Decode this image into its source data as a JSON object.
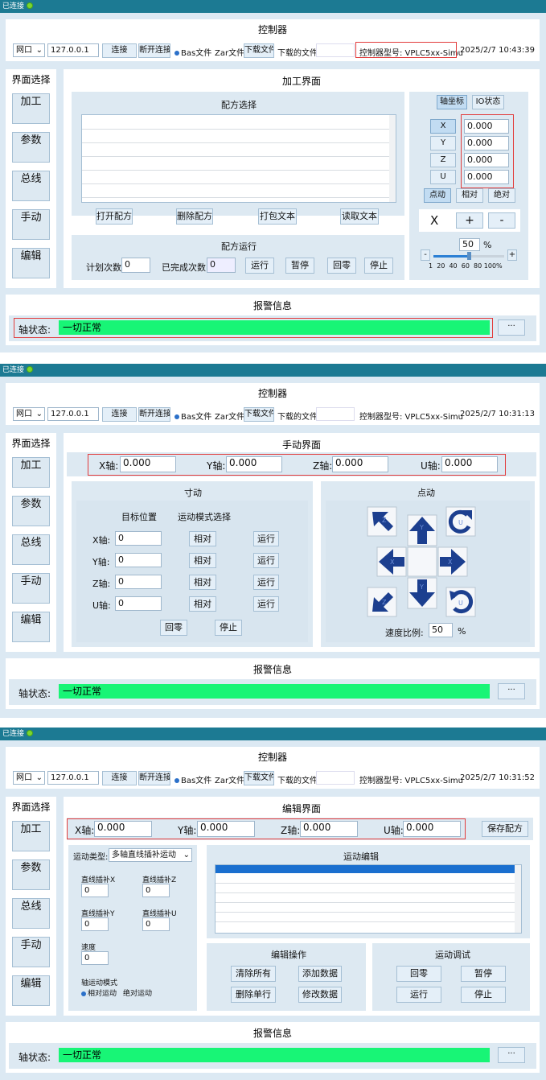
{
  "common": {
    "conn_status": "已连接",
    "controller_title": "控制器",
    "port": "网口",
    "ip": "127.0.0.1",
    "connect": "连接",
    "disconnect": "断开连接",
    "bas_file": "Bas文件",
    "zar_file": "Zar文件",
    "download_file": "下载文件",
    "downloaded_file": "下载的文件:",
    "model": "控制器型号: VPLC5xx-Simu",
    "menu_title": "界面选择",
    "menu": [
      "加工",
      "参数",
      "总线",
      "手动",
      "编辑"
    ],
    "alarm_title": "报警信息",
    "axis_state_label": "轴状态:",
    "axis_state": "一切正常",
    "more": "···"
  },
  "s1": {
    "datetime": "2025/2/7 10:43:39",
    "title": "加工界面",
    "recipe_select": "配方选择",
    "buttons": [
      "打开配方",
      "删除配方",
      "打包文本",
      "读取文本"
    ],
    "recipe_run": "配方运行",
    "plan_count_label": "计划次数",
    "plan_count": "0",
    "done_count_label": "已完成次数",
    "done_count": "0",
    "run_buttons": [
      "运行",
      "暂停",
      "回零",
      "停止"
    ],
    "tab_axis": "轴坐标",
    "tab_io": "IO状态",
    "axes": [
      "X",
      "Y",
      "Z",
      "U"
    ],
    "values": [
      "0.000",
      "0.000",
      "0.000",
      "0.000"
    ],
    "modes": [
      "点动",
      "相对",
      "绝对"
    ],
    "jog_axis": "X",
    "plus": "+",
    "minus": "-",
    "speed": "50",
    "pct": "%",
    "slider_pct": 0.5,
    "scale": [
      "1",
      "20",
      "40",
      "60",
      "80",
      "100%"
    ]
  },
  "s2": {
    "datetime": "2025/2/7 10:31:13",
    "title": "手动界面",
    "axes_labels": [
      "X轴:",
      "Y轴:",
      "Z轴:",
      "U轴:"
    ],
    "axes_values": [
      "0.000",
      "0.000",
      "0.000",
      "0.000"
    ],
    "inch_title": "寸动",
    "target_pos": "目标位置",
    "mode_select": "运动模式选择",
    "rows": [
      {
        "label": "X轴:",
        "value": "0",
        "mode": "相对",
        "run": "运行"
      },
      {
        "label": "Y轴:",
        "value": "0",
        "mode": "相对",
        "run": "运行"
      },
      {
        "label": "Z轴:",
        "value": "0",
        "mode": "相对",
        "run": "运行"
      },
      {
        "label": "U轴:",
        "value": "0",
        "mode": "相对",
        "run": "运行"
      }
    ],
    "home": "回零",
    "stop": "停止",
    "jog_title": "点动",
    "dir_labels": {
      "z": "Z",
      "y": "Y",
      "u": "U",
      "x": "X"
    },
    "speed_label": "速度比例:",
    "speed": "50",
    "pct": "%"
  },
  "s3": {
    "datetime": "2025/2/7 10:31:52",
    "title": "编辑界面",
    "axes_labels": [
      "X轴:",
      "Y轴:",
      "Z轴:",
      "U轴:"
    ],
    "axes_values": [
      "0.000",
      "0.000",
      "0.000",
      "0.000"
    ],
    "save_recipe": "保存配方",
    "motion_type_label": "运动类型:",
    "motion_type": "多轴直线插补运动",
    "fields": [
      {
        "label": "直线插补X",
        "value": "0"
      },
      {
        "label": "直线插补Z",
        "value": "0"
      },
      {
        "label": "直线插补Y",
        "value": "0"
      },
      {
        "label": "直线插补U",
        "value": "0"
      }
    ],
    "speed_label": "速度",
    "speed": "0",
    "axis_mode_label": "轴运动模式",
    "rel": "相对运动",
    "abs": "绝对运动",
    "motion_edit": "运动编辑",
    "edit_ops": "编辑操作",
    "ops": [
      "清除所有",
      "添加数据",
      "删除单行",
      "修改数据"
    ],
    "debug": "运动调试",
    "dbg": [
      "回零",
      "暂停",
      "运行",
      "停止"
    ]
  },
  "colors": {
    "titlebar": "#1c7a93",
    "panel": "#dce9f3",
    "highlight": "#e23b3b",
    "ok": "#18f576",
    "arrow": "#1c3f8f"
  },
  "icons": [
    "arrow-up-left-icon",
    "arrow-up-icon",
    "rotate-cw-icon",
    "arrow-left-icon",
    "arrow-right-icon",
    "arrow-down-left-icon",
    "arrow-down-icon",
    "rotate-ccw-icon"
  ]
}
